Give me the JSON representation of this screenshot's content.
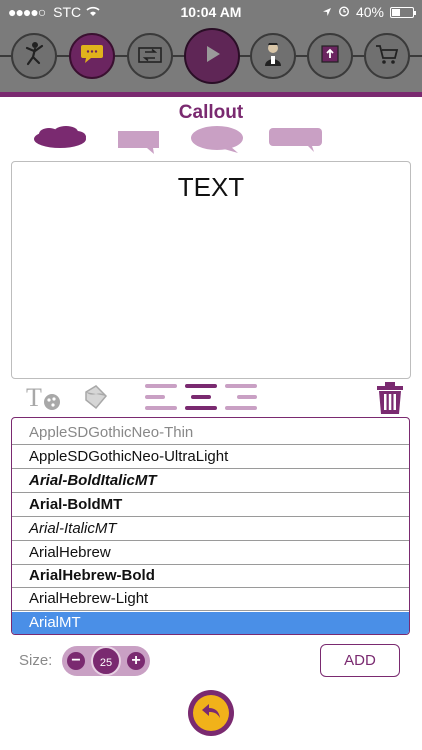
{
  "status_bar": {
    "signal": "●●●●○",
    "carrier": "STC",
    "time": "10:04 AM",
    "battery": "40%",
    "battery_level": 0.4
  },
  "toolbar": {
    "tools": [
      {
        "name": "character-tool",
        "icon": "dancer-icon"
      },
      {
        "name": "callout-tool",
        "icon": "speech-bubble-icon",
        "active": true
      },
      {
        "name": "transition-tool",
        "icon": "swap-icon"
      },
      {
        "name": "play-tool",
        "icon": "play-icon"
      },
      {
        "name": "avatar-tool",
        "icon": "person-icon"
      },
      {
        "name": "export-tool",
        "icon": "upload-icon"
      },
      {
        "name": "store-tool",
        "icon": "cart-icon"
      }
    ]
  },
  "editor": {
    "title": "Callout",
    "shapes": [
      "cloud",
      "rectangle",
      "oval",
      "rounded-rectangle"
    ],
    "text": "TEXT"
  },
  "fonts": {
    "items": [
      {
        "label": "AppleSDGothicNeo-Thin"
      },
      {
        "label": "AppleSDGothicNeo-UltraLight"
      },
      {
        "label": "Arial-BoldItalicMT"
      },
      {
        "label": "Arial-BoldMT"
      },
      {
        "label": "Arial-ItalicMT"
      },
      {
        "label": "ArialHebrew"
      },
      {
        "label": "ArialHebrew-Bold"
      },
      {
        "label": "ArialHebrew-Light"
      },
      {
        "label": "ArialMT"
      }
    ],
    "selected": "ArialMT"
  },
  "size": {
    "label": "Size:",
    "value": "25",
    "minus": "−",
    "plus": "+"
  },
  "actions": {
    "add_label": "ADD"
  },
  "colors": {
    "brand": "#7a2a70",
    "light": "#c9a0c4",
    "selected_row": "#4a8fe7",
    "back_button": "#f1b21a"
  }
}
